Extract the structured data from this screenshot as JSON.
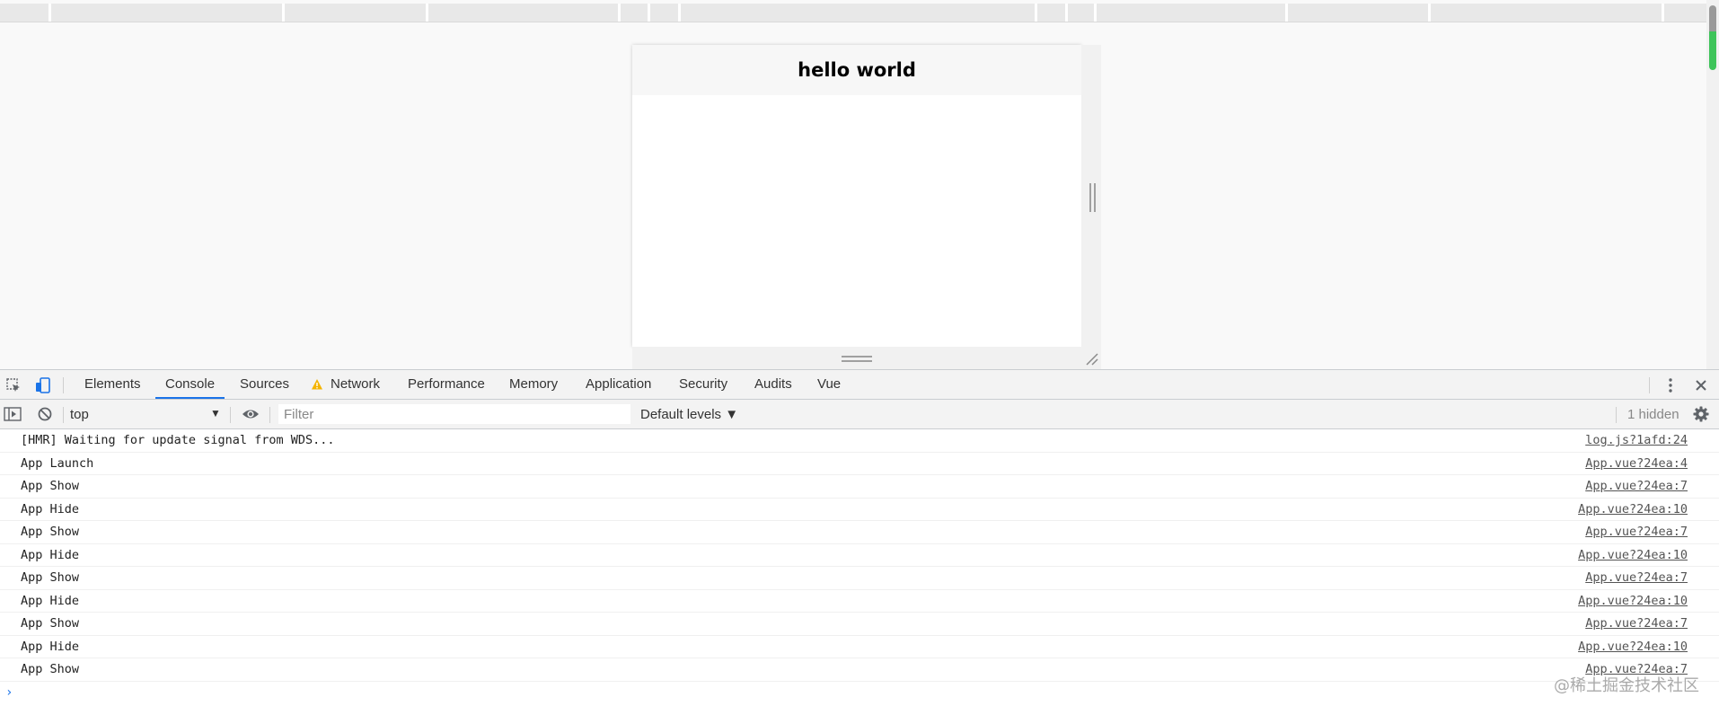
{
  "device_view": {
    "title": "hello world"
  },
  "devtools": {
    "tabs": [
      {
        "label": "Elements"
      },
      {
        "label": "Console",
        "active": true
      },
      {
        "label": "Sources"
      },
      {
        "label": "Network",
        "warning": true
      },
      {
        "label": "Performance"
      },
      {
        "label": "Memory"
      },
      {
        "label": "Application"
      },
      {
        "label": "Security"
      },
      {
        "label": "Audits"
      },
      {
        "label": "Vue"
      }
    ],
    "toolbar": {
      "context": "top",
      "filter_placeholder": "Filter",
      "levels": "Default levels ▼",
      "hidden": "1 hidden"
    },
    "console_rows": [
      {
        "message": "[HMR] Waiting for update signal from WDS...",
        "source": "log.js?1afd:24"
      },
      {
        "message": "App Launch",
        "source": "App.vue?24ea:4"
      },
      {
        "message": "App Show",
        "source": "App.vue?24ea:7"
      },
      {
        "message": "App Hide",
        "source": "App.vue?24ea:10"
      },
      {
        "message": "App Show",
        "source": "App.vue?24ea:7"
      },
      {
        "message": "App Hide",
        "source": "App.vue?24ea:10"
      },
      {
        "message": "App Show",
        "source": "App.vue?24ea:7"
      },
      {
        "message": "App Hide",
        "source": "App.vue?24ea:10"
      },
      {
        "message": "App Show",
        "source": "App.vue?24ea:7"
      },
      {
        "message": "App Hide",
        "source": "App.vue?24ea:10"
      },
      {
        "message": "App Show",
        "source": "App.vue?24ea:7"
      }
    ],
    "prompt": "›"
  },
  "watermark": "@稀土掘金技术社区",
  "colors": {
    "accent": "#1a73e8",
    "warning": "#f4b400",
    "scroll_thumb_green": "#3ec45a"
  },
  "icons": [
    "inspect-icon",
    "device-toggle-icon",
    "warning-icon",
    "more-vert-icon",
    "close-icon",
    "sidebar-toggle-icon",
    "clear-console-icon",
    "eye-icon",
    "settings-gear-icon"
  ]
}
